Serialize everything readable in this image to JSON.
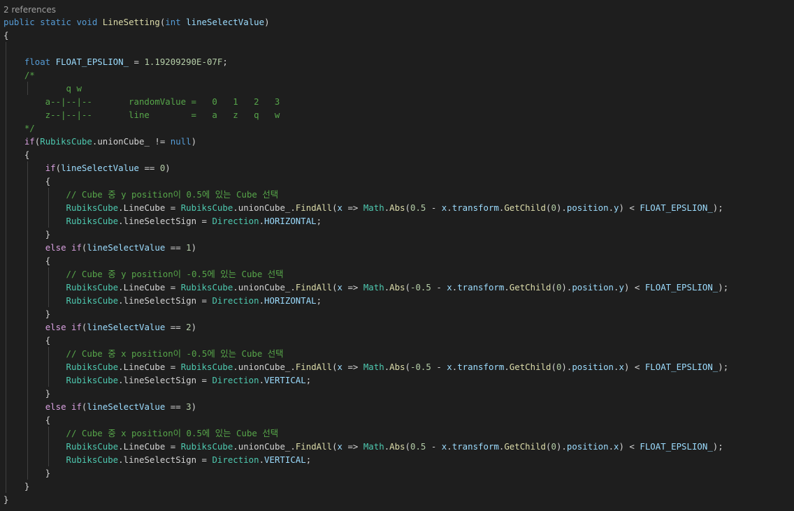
{
  "editor": {
    "codelens": "2 references",
    "colors": {
      "background": "#1e1e1e",
      "keyword": "#569cd6",
      "control": "#d8a0df",
      "type": "#4ec9b0",
      "method": "#dcdcaa",
      "identifier": "#d4d4d4",
      "parameter": "#9cdcfe",
      "number": "#b5cea8",
      "comment": "#57a64a",
      "codelens": "#a0a0a0",
      "indent_guide": "#404040"
    },
    "lines": [
      {
        "indent": 0,
        "tokens": [
          [
            "kw",
            "public"
          ],
          [
            "pn",
            " "
          ],
          [
            "kw",
            "static"
          ],
          [
            "pn",
            " "
          ],
          [
            "kw",
            "void"
          ],
          [
            "pn",
            " "
          ],
          [
            "fn",
            "LineSetting"
          ],
          [
            "pn",
            "("
          ],
          [
            "kw",
            "int"
          ],
          [
            "pn",
            " "
          ],
          [
            "prm",
            "lineSelectValue"
          ],
          [
            "pn",
            ")"
          ]
        ]
      },
      {
        "indent": 0,
        "tokens": [
          [
            "pn",
            "{"
          ]
        ]
      },
      {
        "indent": 1,
        "tokens": []
      },
      {
        "indent": 1,
        "tokens": [
          [
            "kw",
            "float"
          ],
          [
            "pn",
            " "
          ],
          [
            "prm",
            "FLOAT_EPSLION_"
          ],
          [
            "pn",
            " = "
          ],
          [
            "num",
            "1.19209290E-07F"
          ],
          [
            "pn",
            ";"
          ]
        ]
      },
      {
        "indent": 1,
        "tokens": [
          [
            "cm",
            "/*"
          ]
        ]
      },
      {
        "indent": 2,
        "tokens": [
          [
            "cm",
            "    q w"
          ]
        ]
      },
      {
        "indent": 1,
        "tokens": [
          [
            "cm",
            "    a--|--|--       randomValue =   0   1   2   3"
          ]
        ]
      },
      {
        "indent": 1,
        "tokens": [
          [
            "cm",
            "    z--|--|--       line        =   a   z   q   w"
          ]
        ]
      },
      {
        "indent": 1,
        "tokens": [
          [
            "cm",
            "*/"
          ]
        ]
      },
      {
        "indent": 1,
        "tokens": [
          [
            "ctl",
            "if"
          ],
          [
            "pn",
            "("
          ],
          [
            "ty",
            "RubiksCube"
          ],
          [
            "pn",
            "."
          ],
          [
            "id",
            "unionCube_"
          ],
          [
            "pn",
            " != "
          ],
          [
            "kw",
            "null"
          ],
          [
            "pn",
            ")"
          ]
        ]
      },
      {
        "indent": 1,
        "tokens": [
          [
            "pn",
            "{"
          ]
        ]
      },
      {
        "indent": 2,
        "tokens": [
          [
            "ctl",
            "if"
          ],
          [
            "pn",
            "("
          ],
          [
            "prm",
            "lineSelectValue"
          ],
          [
            "pn",
            " == "
          ],
          [
            "num",
            "0"
          ],
          [
            "pn",
            ")"
          ]
        ]
      },
      {
        "indent": 2,
        "tokens": [
          [
            "pn",
            "{"
          ]
        ]
      },
      {
        "indent": 3,
        "tokens": [
          [
            "cm",
            "// Cube 중 y position이 0.5에 있는 Cube 선택"
          ]
        ]
      },
      {
        "indent": 3,
        "tokens": [
          [
            "ty",
            "RubiksCube"
          ],
          [
            "pn",
            "."
          ],
          [
            "id",
            "LineCube"
          ],
          [
            "pn",
            " = "
          ],
          [
            "ty",
            "RubiksCube"
          ],
          [
            "pn",
            "."
          ],
          [
            "id",
            "unionCube_"
          ],
          [
            "pn",
            "."
          ],
          [
            "fn",
            "FindAll"
          ],
          [
            "pn",
            "("
          ],
          [
            "prm",
            "x"
          ],
          [
            "pn",
            " => "
          ],
          [
            "ty",
            "Math"
          ],
          [
            "pn",
            "."
          ],
          [
            "fn",
            "Abs"
          ],
          [
            "pn",
            "("
          ],
          [
            "num",
            "0.5"
          ],
          [
            "pn",
            " - "
          ],
          [
            "prm",
            "x"
          ],
          [
            "pn",
            "."
          ],
          [
            "prm",
            "transform"
          ],
          [
            "pn",
            "."
          ],
          [
            "fn",
            "GetChild"
          ],
          [
            "pn",
            "("
          ],
          [
            "num",
            "0"
          ],
          [
            "pn",
            ")."
          ],
          [
            "prm",
            "position"
          ],
          [
            "pn",
            "."
          ],
          [
            "prm",
            "y"
          ],
          [
            "pn",
            ") < "
          ],
          [
            "prm",
            "FLOAT_EPSLION_"
          ],
          [
            "pn",
            ");"
          ]
        ]
      },
      {
        "indent": 3,
        "tokens": [
          [
            "ty",
            "RubiksCube"
          ],
          [
            "pn",
            "."
          ],
          [
            "id",
            "lineSelectSign"
          ],
          [
            "pn",
            " = "
          ],
          [
            "ty",
            "Direction"
          ],
          [
            "pn",
            "."
          ],
          [
            "prm",
            "HORIZONTAL"
          ],
          [
            "pn",
            ";"
          ]
        ]
      },
      {
        "indent": 2,
        "tokens": [
          [
            "pn",
            "}"
          ]
        ]
      },
      {
        "indent": 2,
        "tokens": [
          [
            "ctl",
            "else"
          ],
          [
            "pn",
            " "
          ],
          [
            "ctl",
            "if"
          ],
          [
            "pn",
            "("
          ],
          [
            "prm",
            "lineSelectValue"
          ],
          [
            "pn",
            " == "
          ],
          [
            "num",
            "1"
          ],
          [
            "pn",
            ")"
          ]
        ]
      },
      {
        "indent": 2,
        "tokens": [
          [
            "pn",
            "{"
          ]
        ]
      },
      {
        "indent": 3,
        "tokens": [
          [
            "cm",
            "// Cube 중 y position이 -0.5에 있는 Cube 선택"
          ]
        ]
      },
      {
        "indent": 3,
        "tokens": [
          [
            "ty",
            "RubiksCube"
          ],
          [
            "pn",
            "."
          ],
          [
            "id",
            "LineCube"
          ],
          [
            "pn",
            " = "
          ],
          [
            "ty",
            "RubiksCube"
          ],
          [
            "pn",
            "."
          ],
          [
            "id",
            "unionCube_"
          ],
          [
            "pn",
            "."
          ],
          [
            "fn",
            "FindAll"
          ],
          [
            "pn",
            "("
          ],
          [
            "prm",
            "x"
          ],
          [
            "pn",
            " => "
          ],
          [
            "ty",
            "Math"
          ],
          [
            "pn",
            "."
          ],
          [
            "fn",
            "Abs"
          ],
          [
            "pn",
            "("
          ],
          [
            "num",
            "-0.5"
          ],
          [
            "pn",
            " - "
          ],
          [
            "prm",
            "x"
          ],
          [
            "pn",
            "."
          ],
          [
            "prm",
            "transform"
          ],
          [
            "pn",
            "."
          ],
          [
            "fn",
            "GetChild"
          ],
          [
            "pn",
            "("
          ],
          [
            "num",
            "0"
          ],
          [
            "pn",
            ")."
          ],
          [
            "prm",
            "position"
          ],
          [
            "pn",
            "."
          ],
          [
            "prm",
            "y"
          ],
          [
            "pn",
            ") < "
          ],
          [
            "prm",
            "FLOAT_EPSLION_"
          ],
          [
            "pn",
            ");"
          ]
        ]
      },
      {
        "indent": 3,
        "tokens": [
          [
            "ty",
            "RubiksCube"
          ],
          [
            "pn",
            "."
          ],
          [
            "id",
            "lineSelectSign"
          ],
          [
            "pn",
            " = "
          ],
          [
            "ty",
            "Direction"
          ],
          [
            "pn",
            "."
          ],
          [
            "prm",
            "HORIZONTAL"
          ],
          [
            "pn",
            ";"
          ]
        ]
      },
      {
        "indent": 2,
        "tokens": [
          [
            "pn",
            "}"
          ]
        ]
      },
      {
        "indent": 2,
        "tokens": [
          [
            "ctl",
            "else"
          ],
          [
            "pn",
            " "
          ],
          [
            "ctl",
            "if"
          ],
          [
            "pn",
            "("
          ],
          [
            "prm",
            "lineSelectValue"
          ],
          [
            "pn",
            " == "
          ],
          [
            "num",
            "2"
          ],
          [
            "pn",
            ")"
          ]
        ]
      },
      {
        "indent": 2,
        "tokens": [
          [
            "pn",
            "{"
          ]
        ]
      },
      {
        "indent": 3,
        "tokens": [
          [
            "cm",
            "// Cube 중 x position이 -0.5에 있는 Cube 선택"
          ]
        ]
      },
      {
        "indent": 3,
        "tokens": [
          [
            "ty",
            "RubiksCube"
          ],
          [
            "pn",
            "."
          ],
          [
            "id",
            "LineCube"
          ],
          [
            "pn",
            " = "
          ],
          [
            "ty",
            "RubiksCube"
          ],
          [
            "pn",
            "."
          ],
          [
            "id",
            "unionCube_"
          ],
          [
            "pn",
            "."
          ],
          [
            "fn",
            "FindAll"
          ],
          [
            "pn",
            "("
          ],
          [
            "prm",
            "x"
          ],
          [
            "pn",
            " => "
          ],
          [
            "ty",
            "Math"
          ],
          [
            "pn",
            "."
          ],
          [
            "fn",
            "Abs"
          ],
          [
            "pn",
            "("
          ],
          [
            "num",
            "-0.5"
          ],
          [
            "pn",
            " - "
          ],
          [
            "prm",
            "x"
          ],
          [
            "pn",
            "."
          ],
          [
            "prm",
            "transform"
          ],
          [
            "pn",
            "."
          ],
          [
            "fn",
            "GetChild"
          ],
          [
            "pn",
            "("
          ],
          [
            "num",
            "0"
          ],
          [
            "pn",
            ")."
          ],
          [
            "prm",
            "position"
          ],
          [
            "pn",
            "."
          ],
          [
            "prm",
            "x"
          ],
          [
            "pn",
            ") < "
          ],
          [
            "prm",
            "FLOAT_EPSLION_"
          ],
          [
            "pn",
            ");"
          ]
        ]
      },
      {
        "indent": 3,
        "tokens": [
          [
            "ty",
            "RubiksCube"
          ],
          [
            "pn",
            "."
          ],
          [
            "id",
            "lineSelectSign"
          ],
          [
            "pn",
            " = "
          ],
          [
            "ty",
            "Direction"
          ],
          [
            "pn",
            "."
          ],
          [
            "prm",
            "VERTICAL"
          ],
          [
            "pn",
            ";"
          ]
        ]
      },
      {
        "indent": 2,
        "tokens": [
          [
            "pn",
            "}"
          ]
        ]
      },
      {
        "indent": 2,
        "tokens": [
          [
            "ctl",
            "else"
          ],
          [
            "pn",
            " "
          ],
          [
            "ctl",
            "if"
          ],
          [
            "pn",
            "("
          ],
          [
            "prm",
            "lineSelectValue"
          ],
          [
            "pn",
            " == "
          ],
          [
            "num",
            "3"
          ],
          [
            "pn",
            ")"
          ]
        ]
      },
      {
        "indent": 2,
        "tokens": [
          [
            "pn",
            "{"
          ]
        ]
      },
      {
        "indent": 3,
        "tokens": [
          [
            "cm",
            "// Cube 중 x position이 0.5에 있는 Cube 선택"
          ]
        ]
      },
      {
        "indent": 3,
        "tokens": [
          [
            "ty",
            "RubiksCube"
          ],
          [
            "pn",
            "."
          ],
          [
            "id",
            "LineCube"
          ],
          [
            "pn",
            " = "
          ],
          [
            "ty",
            "RubiksCube"
          ],
          [
            "pn",
            "."
          ],
          [
            "id",
            "unionCube_"
          ],
          [
            "pn",
            "."
          ],
          [
            "fn",
            "FindAll"
          ],
          [
            "pn",
            "("
          ],
          [
            "prm",
            "x"
          ],
          [
            "pn",
            " => "
          ],
          [
            "ty",
            "Math"
          ],
          [
            "pn",
            "."
          ],
          [
            "fn",
            "Abs"
          ],
          [
            "pn",
            "("
          ],
          [
            "num",
            "0.5"
          ],
          [
            "pn",
            " - "
          ],
          [
            "prm",
            "x"
          ],
          [
            "pn",
            "."
          ],
          [
            "prm",
            "transform"
          ],
          [
            "pn",
            "."
          ],
          [
            "fn",
            "GetChild"
          ],
          [
            "pn",
            "("
          ],
          [
            "num",
            "0"
          ],
          [
            "pn",
            ")."
          ],
          [
            "prm",
            "position"
          ],
          [
            "pn",
            "."
          ],
          [
            "prm",
            "x"
          ],
          [
            "pn",
            ") < "
          ],
          [
            "prm",
            "FLOAT_EPSLION_"
          ],
          [
            "pn",
            ");"
          ]
        ]
      },
      {
        "indent": 3,
        "tokens": [
          [
            "ty",
            "RubiksCube"
          ],
          [
            "pn",
            "."
          ],
          [
            "id",
            "lineSelectSign"
          ],
          [
            "pn",
            " = "
          ],
          [
            "ty",
            "Direction"
          ],
          [
            "pn",
            "."
          ],
          [
            "prm",
            "VERTICAL"
          ],
          [
            "pn",
            ";"
          ]
        ]
      },
      {
        "indent": 2,
        "tokens": [
          [
            "pn",
            "}"
          ]
        ]
      },
      {
        "indent": 1,
        "tokens": [
          [
            "pn",
            "}"
          ]
        ]
      },
      {
        "indent": 0,
        "tokens": [
          [
            "pn",
            "}"
          ]
        ]
      }
    ]
  }
}
